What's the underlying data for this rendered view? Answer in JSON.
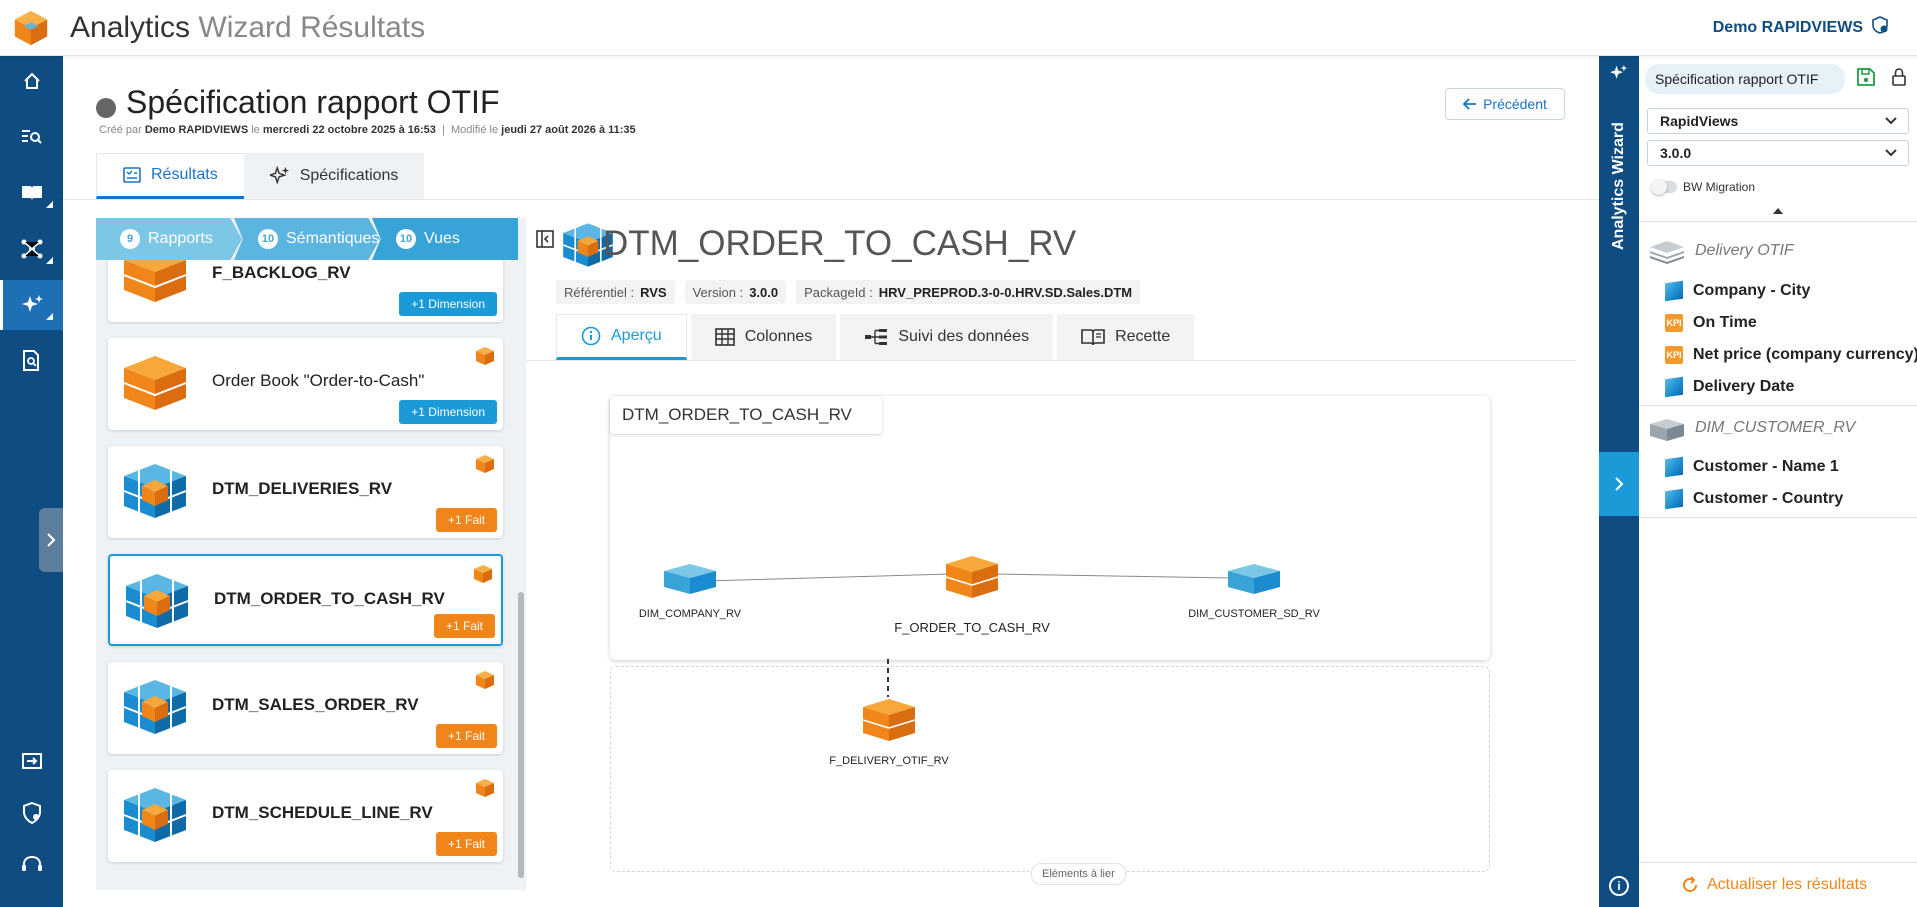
{
  "app": {
    "title_main": "Analytics",
    "title_sub": "Wizard Résultats",
    "user": "Demo RAPIDVIEWS"
  },
  "nav": {
    "items": [
      "home-icon",
      "search-list-icon",
      "book-icon",
      "network-icon",
      "sparkles-icon",
      "document-search-icon",
      "import-icon",
      "security-icon",
      "support-icon"
    ]
  },
  "page": {
    "title": "Spécification rapport OTIF",
    "created_prefix": "Créé par",
    "created_by": "Demo RAPIDVIEWS",
    "created_on_prefix": "le",
    "created_on": "mercredi 22 octobre 2025 à 16:53",
    "separator": "|",
    "modified_prefix": "Modifié le",
    "modified_on": "jeudi 27 août 2026 à 11:35",
    "prev_button": "Précédent",
    "tabs": [
      {
        "label": "Résultats",
        "active": true
      },
      {
        "label": "Spécifications",
        "active": false
      }
    ]
  },
  "steps": [
    {
      "count": "9",
      "label": "Rapports"
    },
    {
      "count": "10",
      "label": "Sémantiques"
    },
    {
      "count": "10",
      "label": "Vues"
    }
  ],
  "list": [
    {
      "name": "F_BACKLOG_RV",
      "badge": "+1 Dimension",
      "badge_color": "blue",
      "cube": "orange"
    },
    {
      "name": "Order Book \"Order-to-Cash\"",
      "badge": "+1 Dimension",
      "badge_color": "blue",
      "cube": "orange"
    },
    {
      "name": "DTM_DELIVERIES_RV",
      "badge": "+1 Fait",
      "badge_color": "orange",
      "cube": "multi"
    },
    {
      "name": "DTM_ORDER_TO_CASH_RV",
      "badge": "+1 Fait",
      "badge_color": "orange",
      "cube": "multi",
      "selected": true
    },
    {
      "name": "DTM_SALES_ORDER_RV",
      "badge": "+1 Fait",
      "badge_color": "orange",
      "cube": "multi"
    },
    {
      "name": "DTM_SCHEDULE_LINE_RV",
      "badge": "+1 Fait",
      "badge_color": "orange",
      "cube": "multi"
    }
  ],
  "detail": {
    "title": "DTM_ORDER_TO_CASH_RV",
    "ref_label": "Référentiel :",
    "ref_value": "RVS",
    "version_label": "Version :",
    "version_value": "3.0.0",
    "package_label": "PackageId :",
    "package_value": "HRV_PREPROD.3-0-0.HRV.SD.Sales.DTM",
    "tabs": [
      {
        "label": "Aperçu",
        "icon": "info-icon",
        "active": true
      },
      {
        "label": "Colonnes",
        "icon": "table-icon"
      },
      {
        "label": "Suivi des données",
        "icon": "lineage-icon"
      },
      {
        "label": "Recette",
        "icon": "open-book-icon"
      }
    ],
    "diagram": {
      "tag": "DTM_ORDER_TO_CASH_RV",
      "nodes": [
        "DIM_COMPANY_RV",
        "F_ORDER_TO_CASH_RV",
        "DIM_CUSTOMER_SD_RV",
        "F_DELIVERY_OTIF_RV"
      ],
      "link_pill": "Eléments à lier"
    }
  },
  "right": {
    "strip_title": "Analytics Wizard",
    "spec_pill": "Spécification rapport OTIF",
    "select1": "RapidViews",
    "select2": "3.0.0",
    "toggle_label": "BW Migration",
    "groups": [
      {
        "title": "Delivery OTIF",
        "fields": [
          {
            "label": "Company - City",
            "type": "dim"
          },
          {
            "label": "On Time",
            "type": "kpi"
          },
          {
            "label": "Net price (company currency)",
            "type": "kpi"
          },
          {
            "label": "Delivery Date",
            "type": "dim"
          }
        ]
      },
      {
        "title": "DIM_CUSTOMER_RV",
        "fields": [
          {
            "label": "Customer - Name 1",
            "type": "dim"
          },
          {
            "label": "Customer - Country",
            "type": "dim"
          }
        ]
      }
    ],
    "kpi_text": "KPI",
    "refresh": "Actualiser les résultats"
  },
  "colors": {
    "nav": "#0f4c81",
    "accent_blue": "#1a9ad6",
    "accent_orange": "#f08519"
  }
}
